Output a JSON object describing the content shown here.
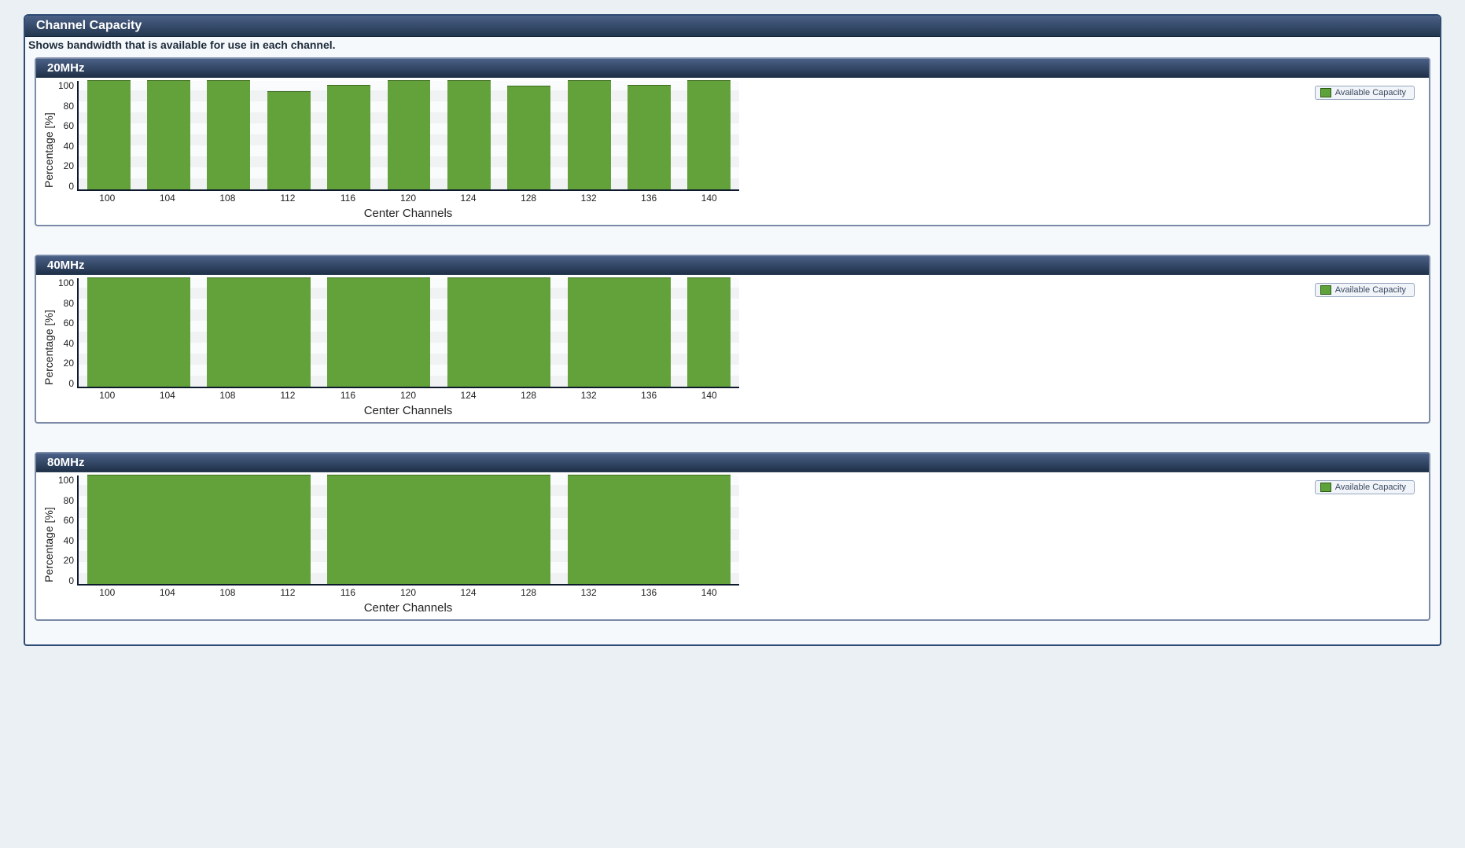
{
  "panel": {
    "title": "Channel Capacity",
    "description": "Shows bandwidth that is available for use in each channel."
  },
  "legend_label": "Available Capacity",
  "axis": {
    "ylabel": "Percentage [%]",
    "xlabel": "Center Channels",
    "yticks": [
      "100",
      "80",
      "60",
      "40",
      "20",
      "0"
    ],
    "xticks": [
      "100",
      "104",
      "108",
      "112",
      "116",
      "120",
      "124",
      "128",
      "132",
      "136",
      "140"
    ]
  },
  "charts": [
    {
      "id": "c20",
      "title": "20MHz"
    },
    {
      "id": "c40",
      "title": "40MHz"
    },
    {
      "id": "c80",
      "title": "80MHz"
    }
  ],
  "chart_data": [
    {
      "type": "bar",
      "title": "20MHz",
      "xlabel": "Center Channels",
      "ylabel": "Percentage [%]",
      "ylim": [
        0,
        100
      ],
      "categories": [
        "100",
        "104",
        "108",
        "112",
        "116",
        "120",
        "124",
        "128",
        "132",
        "136",
        "140"
      ],
      "values": [
        100,
        100,
        100,
        90,
        96,
        100,
        100,
        95,
        100,
        96,
        100
      ],
      "legend": "Available Capacity",
      "bar_span": 1
    },
    {
      "type": "bar",
      "title": "40MHz",
      "xlabel": "Center Channels",
      "ylabel": "Percentage [%]",
      "ylim": [
        0,
        100
      ],
      "categories": [
        "100",
        "104",
        "108",
        "112",
        "116",
        "120",
        "124",
        "128",
        "132",
        "136",
        "140"
      ],
      "legend": "Available Capacity",
      "groups": [
        {
          "start": "100",
          "end": "104",
          "value": 100
        },
        {
          "start": "108",
          "end": "112",
          "value": 100
        },
        {
          "start": "116",
          "end": "120",
          "value": 100
        },
        {
          "start": "124",
          "end": "128",
          "value": 100
        },
        {
          "start": "132",
          "end": "136",
          "value": 100
        },
        {
          "start": "140",
          "end": "140",
          "value": 100
        }
      ],
      "bar_span": 2
    },
    {
      "type": "bar",
      "title": "80MHz",
      "xlabel": "Center Channels",
      "ylabel": "Percentage [%]",
      "ylim": [
        0,
        100
      ],
      "categories": [
        "100",
        "104",
        "108",
        "112",
        "116",
        "120",
        "124",
        "128",
        "132",
        "136",
        "140"
      ],
      "legend": "Available Capacity",
      "groups": [
        {
          "start": "100",
          "end": "112",
          "value": 100
        },
        {
          "start": "116",
          "end": "128",
          "value": 100
        },
        {
          "start": "132",
          "end": "140",
          "value": 100
        }
      ],
      "bar_span": 4
    }
  ]
}
